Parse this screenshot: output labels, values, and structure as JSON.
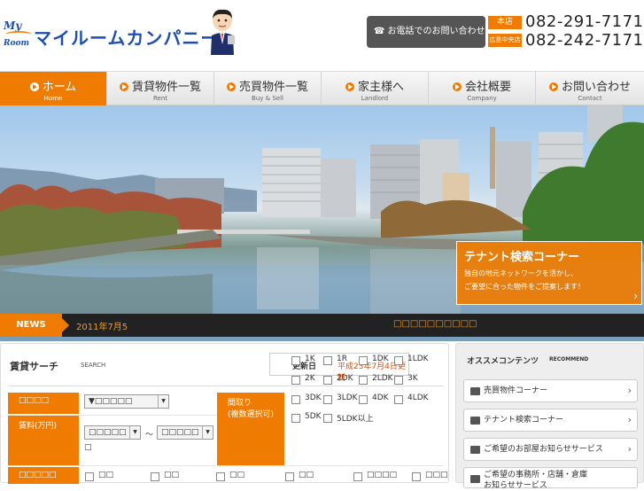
{
  "header": {
    "logo_my": "My",
    "logo_room": "Room",
    "company_name": "マイルームカンパニー",
    "phone_label": "お電話でのお問い合わせ",
    "phone_icon": "telephone-icon",
    "branches": [
      {
        "badge": "本店",
        "number": "082-291-7171"
      },
      {
        "badge": "広島中央店",
        "number": "082-242-7171"
      }
    ]
  },
  "nav": {
    "items": [
      {
        "label": "ホーム",
        "sub": "Home",
        "active": true
      },
      {
        "label": "賃貸物件一覧",
        "sub": "Rent"
      },
      {
        "label": "売買物件一覧",
        "sub": "Buy & Sell"
      },
      {
        "label": "家主様へ",
        "sub": "Landlord"
      },
      {
        "label": "会社概要",
        "sub": "Company"
      },
      {
        "label": "お問い合わせ",
        "sub": "Contact"
      }
    ]
  },
  "hero": {
    "tenant_title": "テナント検索コーナー",
    "tenant_line1": "独自の地元ネットワークを活かし、",
    "tenant_line2": "ご要望に合った物件をご提案します！",
    "tenant_chevron": "›"
  },
  "news": {
    "label": "NEWS",
    "date": "2011年7月5",
    "text": "□□□□□□□□□□"
  },
  "search": {
    "title": "賃貸サーチ",
    "subtitle": "SEARCH",
    "updated_label": "更新日",
    "updated_value": "平成23年7月4日更新",
    "field_type_label": "□□□□",
    "field_type_value": "▼□□□□□",
    "field_price_label": "賃料(万円)",
    "price_min": "□□□□□",
    "price_tilde": "～",
    "price_max": "□□□□□",
    "price_note": "□",
    "field_layout_label": "間取り",
    "field_layout_sub": "(複数選択可)",
    "layouts": [
      "1K",
      "1R",
      "1DK",
      "1LDK",
      "2K",
      "2DK",
      "2LDK",
      "3K",
      "3DK",
      "3LDK",
      "4DK",
      "4LDK",
      "5DK",
      "5LDK以上"
    ],
    "field_area_label": "□□□□□",
    "areas": [
      "□□",
      "□□",
      "□□",
      "□□",
      "□□□□",
      "□□□",
      "□□□"
    ]
  },
  "recommend": {
    "title": "オススメコンテンツ",
    "subtitle": "RECOMMEND",
    "items": [
      {
        "label": "売買物件コーナー",
        "icon": "building-icon"
      },
      {
        "label": "テナント検索コーナー",
        "icon": "building-icon"
      },
      {
        "label": "ご希望のお部屋お知らせサービス",
        "icon": "mail-icon"
      },
      {
        "label": "ご希望の事務所・店舗・倉庫",
        "icon": "mail-icon"
      }
    ],
    "item4_cut": "お知らせサービス",
    "chevron": "›"
  },
  "colors": {
    "accent": "#ef7c00",
    "brand_blue": "#1e4fb0",
    "news_bg": "#222222"
  }
}
